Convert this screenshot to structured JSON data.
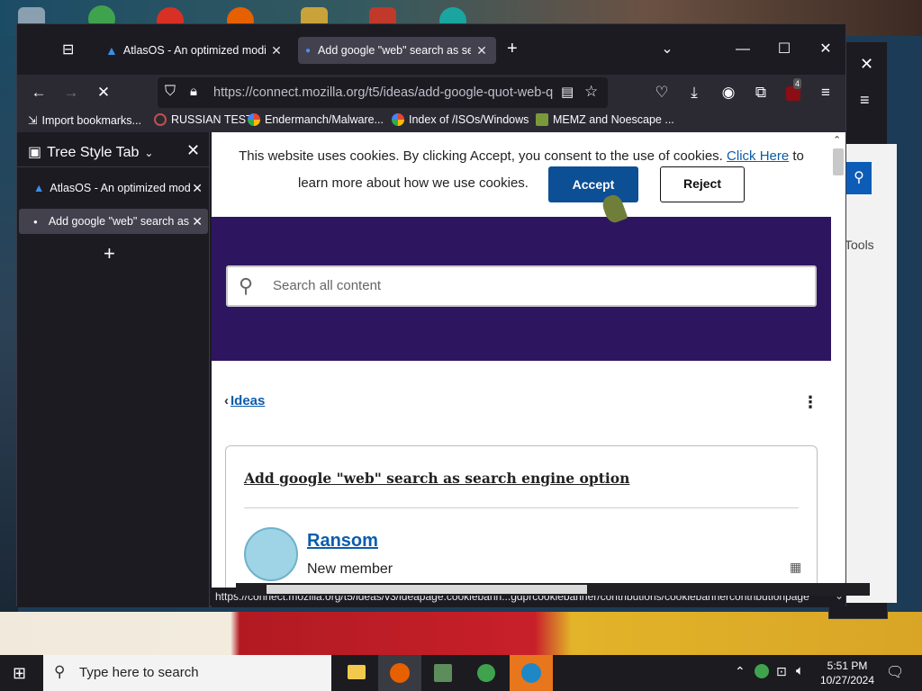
{
  "browser": {
    "tabs": [
      {
        "title": "AtlasOS - An optimized modific",
        "active": false
      },
      {
        "title": "Add google \"web\" search as sea",
        "active": true
      }
    ],
    "url": "https://connect.mozilla.org/t5/ideas/add-google-quot-web-q",
    "extension_badge": "4",
    "bookmarks": [
      {
        "label": "Import bookmarks...",
        "icon": "import-icon"
      },
      {
        "label": "RUSSIAN TEST",
        "icon": "magnifier-icon"
      },
      {
        "label": "Endermanch/Malware...",
        "icon": "google-icon"
      },
      {
        "label": "Index of /ISOs/Windows",
        "icon": "google-icon"
      },
      {
        "label": "MEMZ and Noescape ...",
        "icon": "site-icon"
      }
    ]
  },
  "sidebar": {
    "title": "Tree Style Tab",
    "tabs": [
      {
        "title": "AtlasOS - An optimized mod"
      },
      {
        "title": "Add google \"web\" search as"
      }
    ]
  },
  "page": {
    "cookie_text_1": "This website uses cookies. By clicking Accept, you consent to the use of cookies.",
    "cookie_link": "Click Here",
    "cookie_text_2": "to",
    "cookie_text_3": "learn more about how we use cookies.",
    "accept_label": "Accept",
    "reject_label": "Reject",
    "search_placeholder": "Search all content",
    "back_link": "Ideas",
    "post_title": "Add google \"web\" search as search engine option",
    "author": "Ransom",
    "author_rank": "New member"
  },
  "status_url": "https://connect.mozilla.org/t5/ideas/v3/ideapage.cookiebann...gdprcookiebanner/contributions/cookiebannercontributionpage",
  "bg_window": {
    "tools_label": "Tools"
  },
  "taskbar": {
    "search_placeholder": "Type here to search",
    "time": "5:51 PM",
    "date": "10/27/2024"
  },
  "colors": {
    "hero": "#2d165f",
    "accept": "#0d4f94",
    "link": "#0b5cad"
  }
}
